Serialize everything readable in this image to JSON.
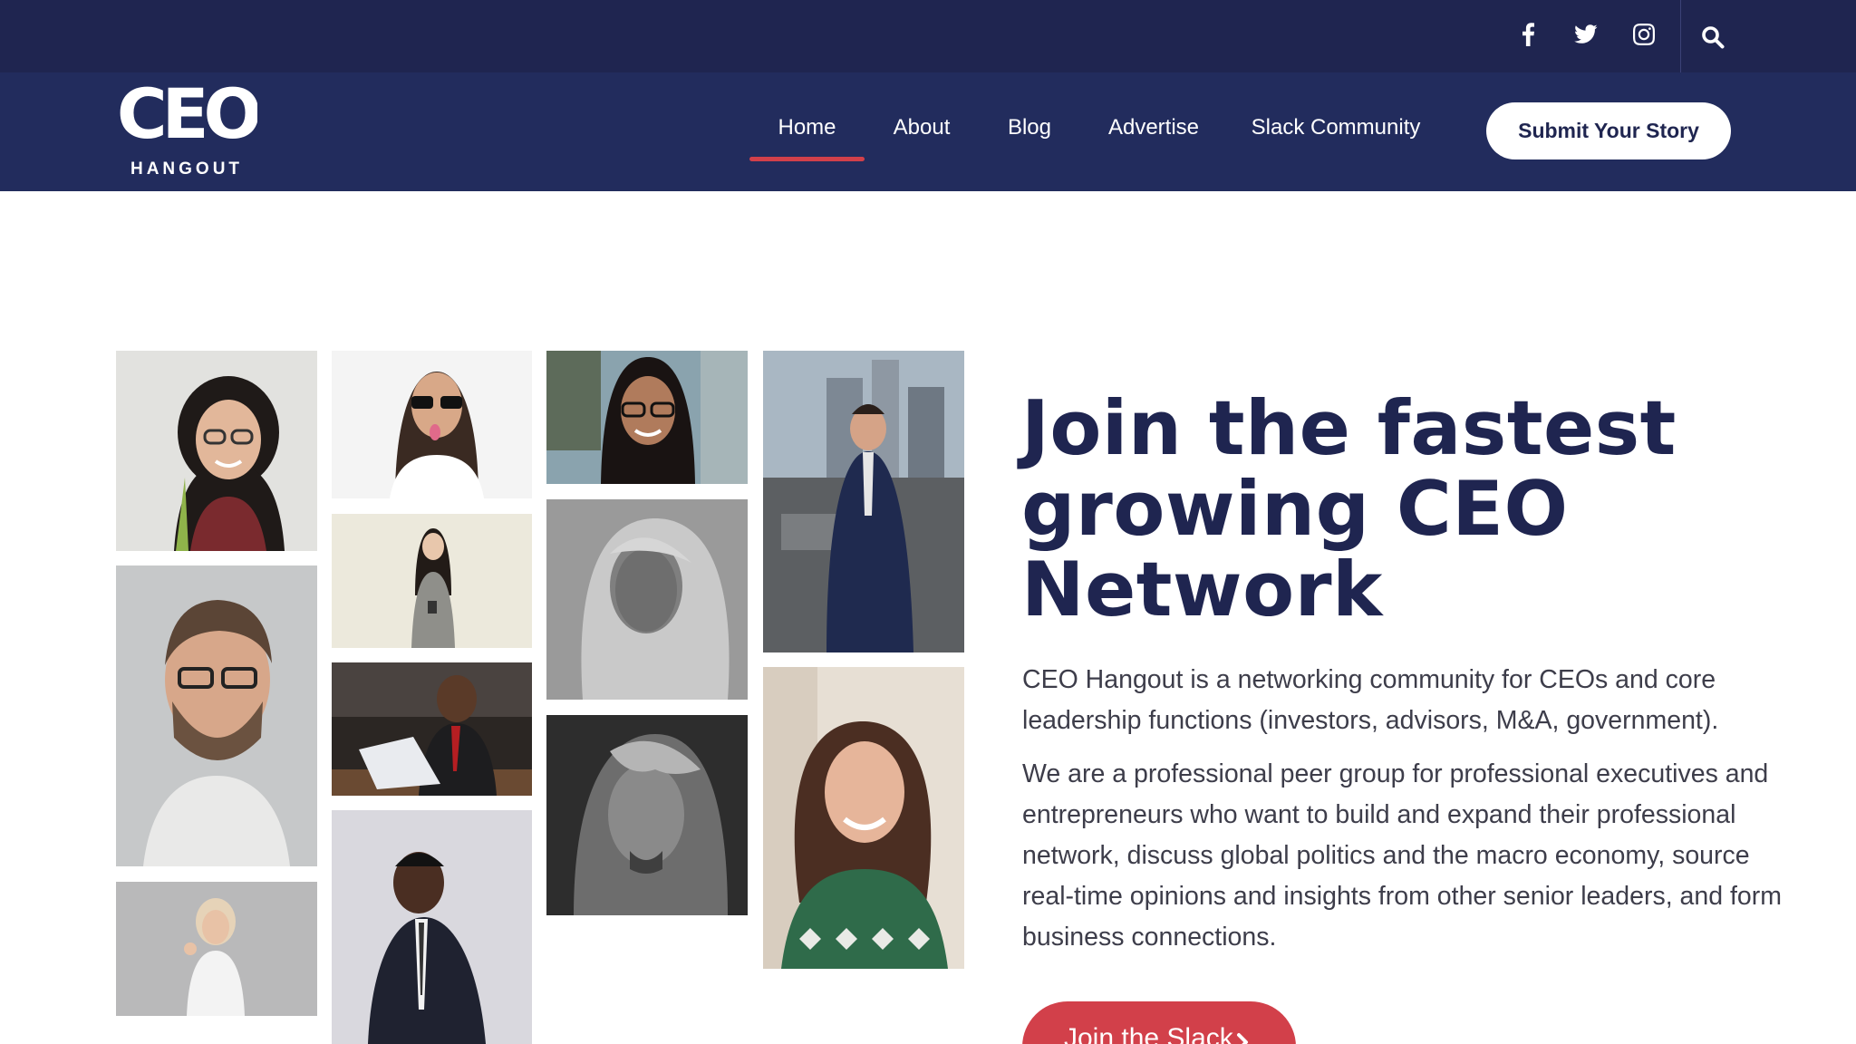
{
  "colors": {
    "topbar_bg": "#1f2550",
    "navbar_bg": "#222c5d",
    "accent_red": "#d2404a",
    "headline_navy": "#1f2550",
    "body_text": "#3d3d4a"
  },
  "topbar": {
    "social_icons": [
      "facebook-icon",
      "twitter-icon",
      "instagram-icon"
    ],
    "search_icon": "search-icon"
  },
  "brand": {
    "logo_text": "CEO",
    "logo_sub": "HANGOUT"
  },
  "nav": {
    "items": [
      {
        "label": "Home",
        "active": true
      },
      {
        "label": "About",
        "active": false
      },
      {
        "label": "Blog",
        "active": false
      },
      {
        "label": "Advertise",
        "active": false
      },
      {
        "label": "Slack Community",
        "active": false
      }
    ],
    "submit_label": "Submit Your Story"
  },
  "hero": {
    "headline": "Join the fastest growing CEO Network",
    "paragraph1": "CEO Hangout is a networking community for CEOs and core leadership functions (investors, advisors, M&A, government).",
    "paragraph2": "We are a professional peer group for professional executives and entrepreneurs who want to build and expand their professional network, discuss global politics and the macro economy, source real-time opinions and insights from other senior leaders, and form business connections.",
    "cta_label": "Join the Slack",
    "cta_icon": "chevron-right-icon"
  }
}
